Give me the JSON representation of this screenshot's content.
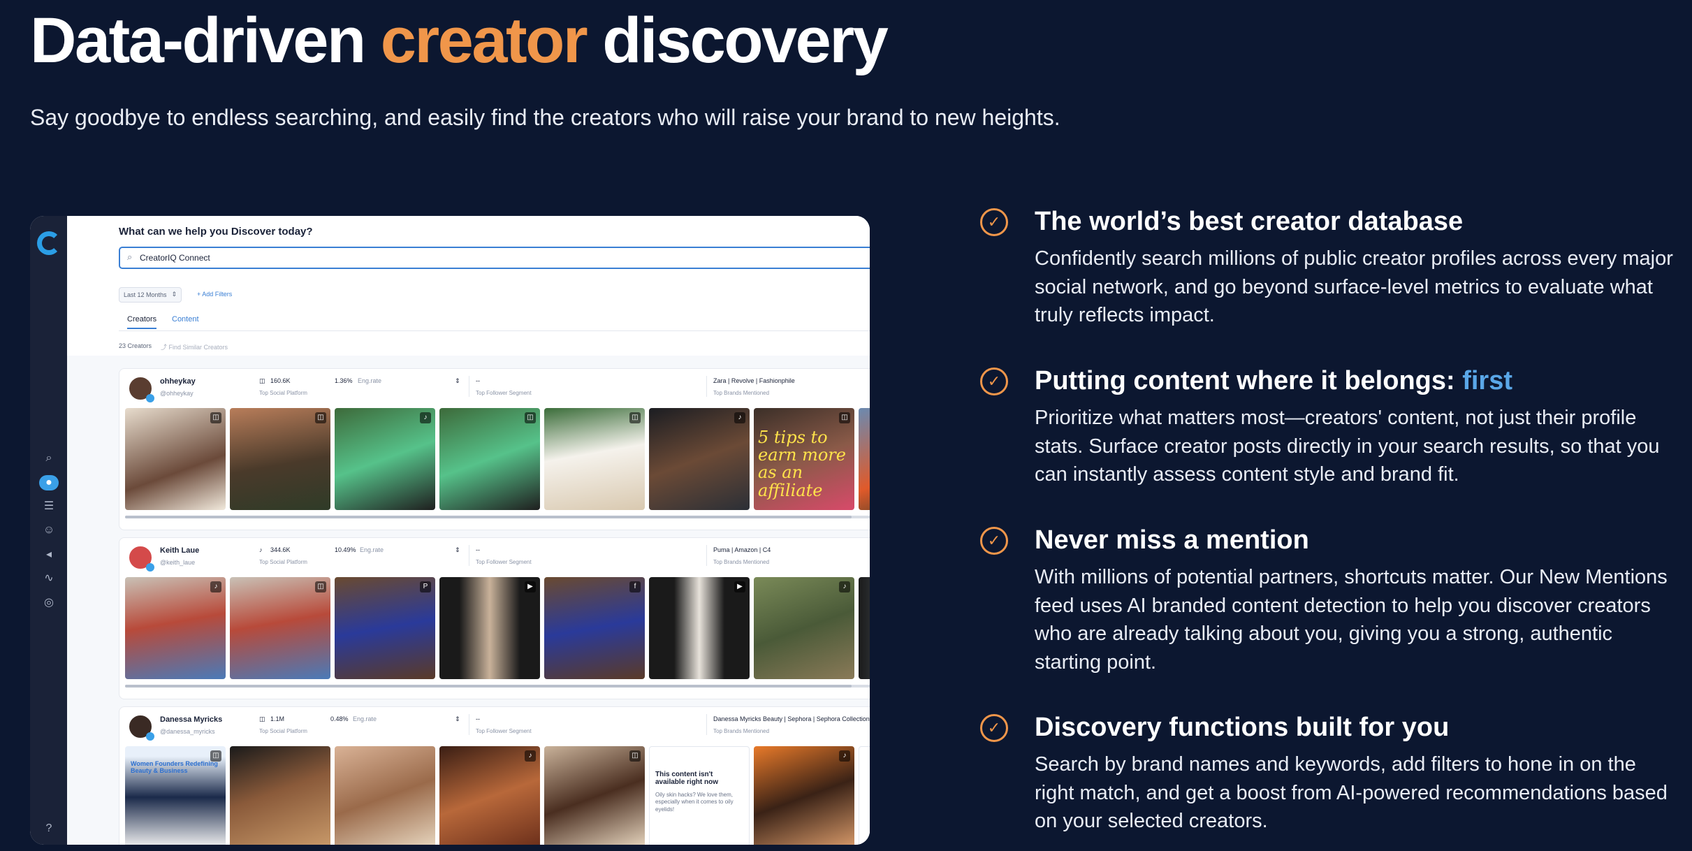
{
  "hero": {
    "title_pre": "Data-driven ",
    "title_accent": "creator",
    "title_post": " discovery",
    "subtitle": "Say goodbye to endless searching, and easily find the creators who will raise your brand to new heights."
  },
  "app": {
    "question": "What can we help you Discover today?",
    "search_value": "CreatorIQ Connect",
    "date_filter": "Last 12 Months",
    "add_filters": "+ Add Filters",
    "tabs": [
      "Creators",
      "Content"
    ],
    "count": "23 Creators",
    "similar": "Find Similar Creators",
    "creators": [
      {
        "name": "ohheykay",
        "handle": "@ohheykay",
        "followers": "160.6K",
        "followers_label": "Top Social Platform",
        "eng": "1.36%",
        "eng_label": "Eng.rate",
        "segment": "--",
        "segment_label": "Top Follower Segment",
        "brands": "Zara | Revolve | Fashionphile",
        "brands_label": "Top Brands Mentioned",
        "post_text": "5 tips to earn more as an affiliate"
      },
      {
        "name": "Keith Laue",
        "handle": "@keith_laue",
        "followers": "344.6K",
        "followers_label": "Top Social Platform",
        "eng": "10.49%",
        "eng_label": "Eng.rate",
        "segment": "--",
        "segment_label": "Top Follower Segment",
        "brands": "Puma | Amazon | C4",
        "brands_label": "Top Brands Mentioned"
      },
      {
        "name": "Danessa Myricks",
        "handle": "@danessa_myricks",
        "followers": "1.1M",
        "followers_label": "Top Social Platform",
        "eng": "0.48%",
        "eng_label": "Eng.rate",
        "segment": "--",
        "segment_label": "Top Follower Segment",
        "brands": "Danessa Myricks Beauty | Sephora | Sephora Collection",
        "brands_label": "Top Brands Mentioned",
        "post_text": "Women Founders Redefining Beauty & Business",
        "unavailable_title": "This content isn't available right now",
        "unavailable_sub": "Oily skin hacks? We love them, especially when it comes to oily eyelids!"
      }
    ]
  },
  "features": [
    {
      "title": "The world’s best creator database",
      "body": "Confidently search millions of public creator profiles across every major social network, and go beyond surface-level metrics to evaluate what truly reflects impact."
    },
    {
      "title": "Putting content where it belongs: ",
      "title_accent": "first",
      "body": "Prioritize what matters most—creators' content, not just their profile stats. Surface creator posts directly in your search results, so that you can instantly assess content style and brand fit."
    },
    {
      "title": "Never miss a mention",
      "body": "With millions of potential partners, shortcuts matter. Our New Mentions feed uses AI branded content detection to help you discover creators who are already talking about you, giving you a strong, authentic starting point."
    },
    {
      "title": "Discovery functions built for you",
      "body": "Search by brand names and keywords, add filters to hone in on the right match, and get a boost from AI-powered recommendations based on your selected creators."
    }
  ],
  "colors": {
    "background": "#0c1730",
    "accent_orange": "#f0964a",
    "accent_blue": "#5aa7e8"
  }
}
